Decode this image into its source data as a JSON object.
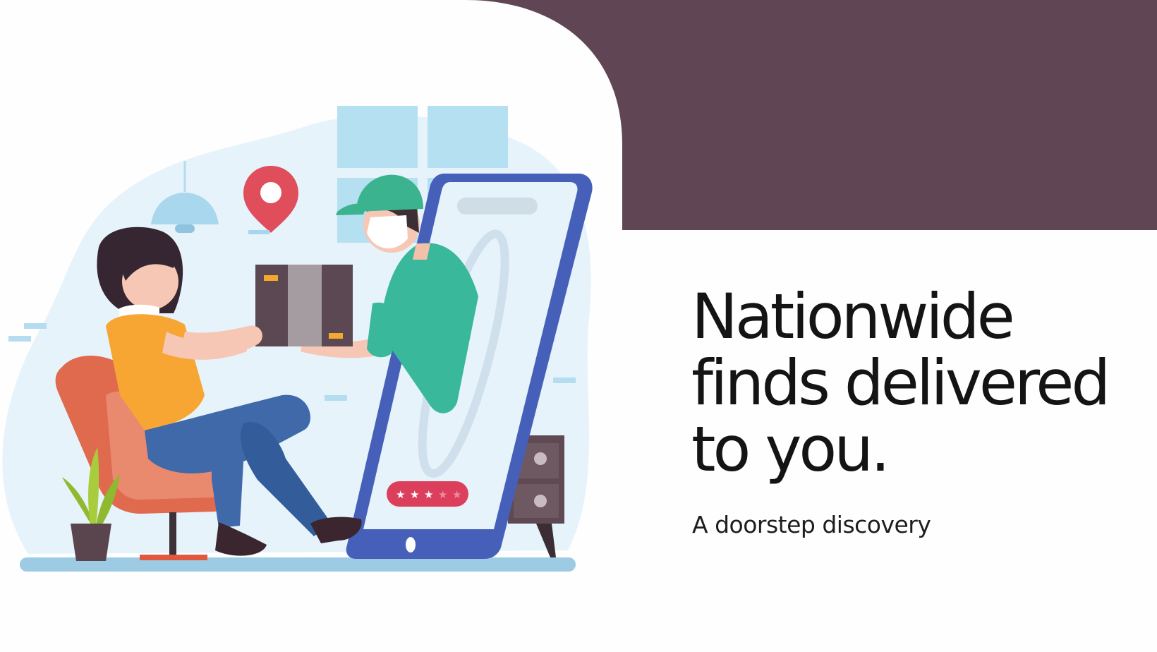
{
  "slide": {
    "headline_lines": [
      "Nationwide",
      "finds delivered",
      "to you."
    ],
    "subtitle": "A doorstep discovery"
  },
  "illustration": {
    "rating_stars_filled": 3,
    "rating_stars_total": 5
  },
  "colors": {
    "accent_panel": "#604655",
    "background": "#fefefe",
    "text": "#141414"
  },
  "icons": [
    "location-pin-icon",
    "star-icon",
    "pendant-lamp-icon"
  ]
}
